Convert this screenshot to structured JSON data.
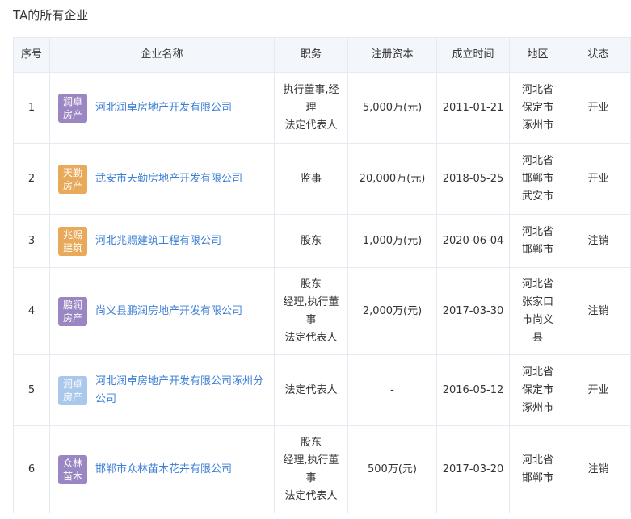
{
  "section_title": "TA的所有企业",
  "headers": {
    "index": "序号",
    "name": "企业名称",
    "position": "职务",
    "capital": "注册资本",
    "date": "成立时间",
    "region": "地区",
    "status": "状态"
  },
  "colors": {
    "logo_purple": "#9a86c2",
    "logo_orange": "#e9a95a",
    "logo_light_blue": "#a9c8ec",
    "status_open": "#3c9a3c",
    "status_closed": "#e05c5c",
    "link": "#3d7fd6"
  },
  "rows": [
    {
      "index": "1",
      "logo_text": "润卓房产",
      "logo_color": "#9a86c2",
      "name": "河北润卓房地产开发有限公司",
      "position": "执行董事,经\n理\n法定代表人",
      "capital": "5,000万(元)",
      "date": "2011-01-21",
      "region": "河北省\n保定市\n涿州市",
      "status": "开业",
      "status_type": "open"
    },
    {
      "index": "2",
      "logo_text": "天勤房产",
      "logo_color": "#e9a95a",
      "name": "武安市天勤房地产开发有限公司",
      "position": "监事",
      "capital": "20,000万(元)",
      "date": "2018-05-25",
      "region": "河北省\n邯郸市\n武安市",
      "status": "开业",
      "status_type": "open"
    },
    {
      "index": "3",
      "logo_text": "兆赐建筑",
      "logo_color": "#e9a95a",
      "name": "河北兆赐建筑工程有限公司",
      "position": "股东",
      "capital": "1,000万(元)",
      "date": "2020-06-04",
      "region": "河北省\n邯郸市",
      "status": "注销",
      "status_type": "closed"
    },
    {
      "index": "4",
      "logo_text": "鹏润房产",
      "logo_color": "#9a86c2",
      "name": "尚义县鹏润房地产开发有限公司",
      "position": "股东\n经理,执行董\n事\n法定代表人",
      "capital": "2,000万(元)",
      "date": "2017-03-30",
      "region": "河北省\n张家口\n市尚义\n县",
      "status": "注销",
      "status_type": "closed"
    },
    {
      "index": "5",
      "logo_text": "润卓房产",
      "logo_color": "#a9c8ec",
      "name": "河北润卓房地产开发有限公司涿州分公司",
      "position": "法定代表人",
      "capital": "-",
      "date": "2016-05-12",
      "region": "河北省\n保定市\n涿州市",
      "status": "开业",
      "status_type": "open"
    },
    {
      "index": "6",
      "logo_text": "众林苗木",
      "logo_color": "#9a86c2",
      "name": "邯郸市众林苗木花卉有限公司",
      "position": "股东\n经理,执行董\n事\n法定代表人",
      "capital": "500万(元)",
      "date": "2017-03-20",
      "region": "河北省\n邯郸市",
      "status": "注销",
      "status_type": "closed"
    }
  ]
}
